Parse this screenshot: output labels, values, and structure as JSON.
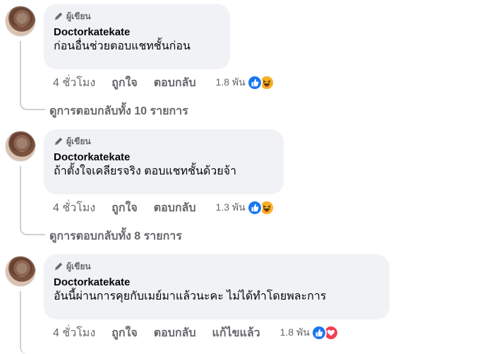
{
  "comments": [
    {
      "badge": "ผู้เขียน",
      "author": "Doctorkatekate",
      "text": "ก่อนอื่นช่วยตอบแชทชั้นก่อน",
      "time": "4 ชั่วโมง",
      "like_action": "ถูกใจ",
      "reply_action": "ตอบกลับ",
      "reaction_count": "1.8 พัน",
      "reactions": [
        "like-icon",
        "haha-icon"
      ],
      "view_replies": "ดูการตอบกลับทั้ง 10 รายการ"
    },
    {
      "badge": "ผู้เขียน",
      "author": "Doctorkatekate",
      "text": "ถ้าตั้งใจเคลียรจริง ตอบแชทชั้นด้วยจ้า",
      "time": "4 ชั่วโมง",
      "like_action": "ถูกใจ",
      "reply_action": "ตอบกลับ",
      "reaction_count": "1.3 พัน",
      "reactions": [
        "like-icon",
        "haha-icon"
      ],
      "view_replies": "ดูการตอบกลับทั้ง 8 รายการ"
    },
    {
      "badge": "ผู้เขียน",
      "author": "Doctorkatekate",
      "text": "อันนี้ผ่านการคุยกับเมย์มาแล้วนะคะ ไม่ได้ทำโดยพละการ",
      "time": "4 ชั่วโมง",
      "like_action": "ถูกใจ",
      "reply_action": "ตอบกลับ",
      "edited": "แก้ไขแล้ว",
      "reaction_count": "1.8 พัน",
      "reactions": [
        "like-icon",
        "love-icon"
      ]
    }
  ],
  "colors": {
    "like": "#1877f2",
    "haha": "#f7b125",
    "love": "#f33e58",
    "bubble": "#f0f2f5",
    "meta": "#65676b"
  }
}
